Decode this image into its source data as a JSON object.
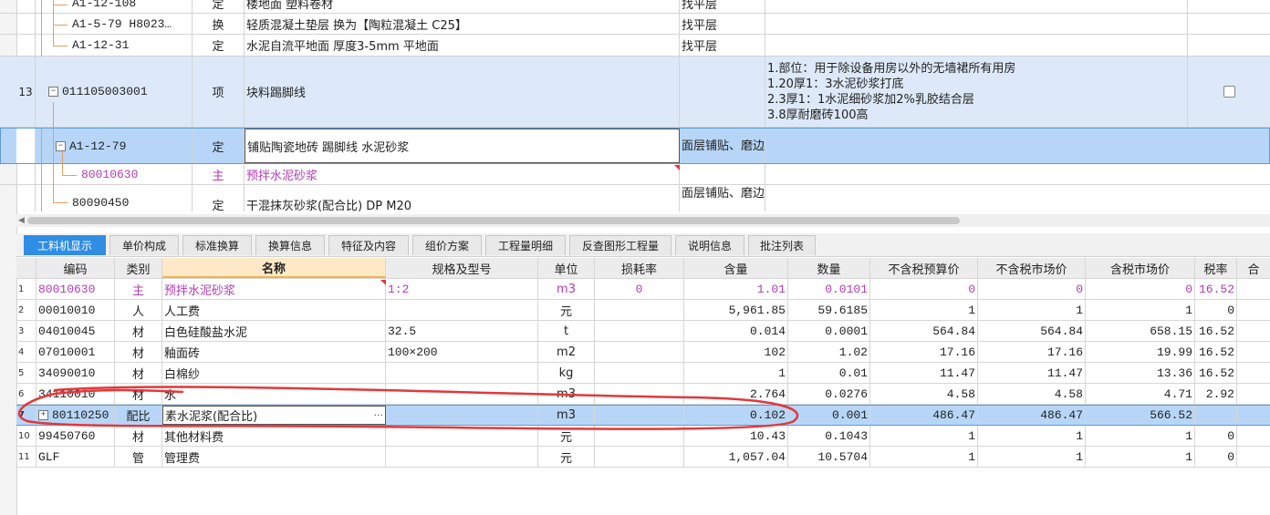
{
  "upper_rows": [
    {
      "num": "",
      "code": "A1-12-108",
      "type": "定",
      "name": "楼地面 塑料卷材",
      "part": "找平层",
      "desc": []
    },
    {
      "num": "",
      "code": "A1-5-79 H8023…",
      "type": "换",
      "name": "轻质混凝土垫层  换为【陶粒混凝土 C25】",
      "part": "找平层",
      "desc": []
    },
    {
      "num": "",
      "code": "A1-12-31",
      "type": "定",
      "name": "水泥自流平地面 厚度3-5mm 平地面",
      "part": "找平层",
      "desc": []
    },
    {
      "num": "13",
      "code": "011105003001",
      "type": "项",
      "name": "块料踢脚线",
      "part": "",
      "desc": [
        "1.部位：用于除设备用房以外的无墙裙所有用房",
        "1.20厚1：3水泥砂浆打底",
        "2.3厚1：1水泥细砂浆加2%乳胶结合层",
        "3.8厚耐磨砖100高"
      ]
    },
    {
      "num": "",
      "code": "A1-12-79",
      "type": "定",
      "name": "铺贴陶瓷地砖 踢脚线 水泥砂浆",
      "part": "面层铺贴、磨边",
      "desc": []
    },
    {
      "num": "",
      "code": "80010630",
      "type": "主",
      "name": "预拌水泥砂浆",
      "part": "",
      "desc": []
    },
    {
      "num": "",
      "code": "80090450",
      "type": "定",
      "name": "干混抹灰砂浆(配合比) DP M20",
      "part": "面层铺贴、磨边",
      "desc": []
    }
  ],
  "tabs": [
    "工料机显示",
    "单价构成",
    "标准换算",
    "换算信息",
    "特征及内容",
    "组价方案",
    "工程量明细",
    "反查图形工程量",
    "说明信息",
    "批注列表"
  ],
  "columns": [
    "编码",
    "类别",
    "名称",
    "规格及型号",
    "单位",
    "损耗率",
    "含量",
    "数量",
    "不含税预算价",
    "不含税市场价",
    "含税市场价",
    "税率",
    "合"
  ],
  "rows": [
    {
      "rn": "1",
      "code": "80010630",
      "type": "主",
      "name": "预拌水泥砂浆",
      "spec": "1:2",
      "unit": "m3",
      "loss": "0",
      "content": "1.01",
      "qty": "0.0101",
      "budget": "0",
      "market": "0",
      "taxmarket": "0",
      "tax": "16.52"
    },
    {
      "rn": "2",
      "code": "00010010",
      "type": "人",
      "name": "人工费",
      "spec": "",
      "unit": "元",
      "loss": "",
      "content": "5,961.85",
      "qty": "59.6185",
      "budget": "1",
      "market": "1",
      "taxmarket": "1",
      "tax": "0"
    },
    {
      "rn": "3",
      "code": "04010045",
      "type": "材",
      "name": "白色硅酸盐水泥",
      "spec": "32.5",
      "unit": "t",
      "loss": "",
      "content": "0.014",
      "qty": "0.0001",
      "budget": "564.84",
      "market": "564.84",
      "taxmarket": "658.15",
      "tax": "16.52"
    },
    {
      "rn": "4",
      "code": "07010001",
      "type": "材",
      "name": "釉面砖",
      "spec": "100×200",
      "unit": "m2",
      "loss": "",
      "content": "102",
      "qty": "1.02",
      "budget": "17.16",
      "market": "17.16",
      "taxmarket": "19.99",
      "tax": "16.52"
    },
    {
      "rn": "5",
      "code": "34090010",
      "type": "材",
      "name": "白棉纱",
      "spec": "",
      "unit": "kg",
      "loss": "",
      "content": "1",
      "qty": "0.01",
      "budget": "11.47",
      "market": "11.47",
      "taxmarket": "13.36",
      "tax": "16.52"
    },
    {
      "rn": "6",
      "code": "34110010",
      "type": "材",
      "name": "水",
      "spec": "",
      "unit": "m3",
      "loss": "",
      "content": "2.764",
      "qty": "0.0276",
      "budget": "4.58",
      "market": "4.58",
      "taxmarket": "4.71",
      "tax": "2.92"
    },
    {
      "rn": "7",
      "code": "80110250",
      "type": "配比",
      "name": "素水泥浆(配合比)",
      "spec": "",
      "unit": "m3",
      "loss": "",
      "content": "0.102",
      "qty": "0.001",
      "budget": "486.47",
      "market": "486.47",
      "taxmarket": "566.52",
      "tax": ""
    },
    {
      "rn": "10",
      "code": "99450760",
      "type": "材",
      "name": "其他材料费",
      "spec": "",
      "unit": "元",
      "loss": "",
      "content": "10.43",
      "qty": "0.1043",
      "budget": "1",
      "market": "1",
      "taxmarket": "1",
      "tax": "0"
    },
    {
      "rn": "11",
      "code": "GLF",
      "type": "管",
      "name": "管理费",
      "spec": "",
      "unit": "元",
      "loss": "",
      "content": "1,057.04",
      "qty": "10.5704",
      "budget": "1",
      "market": "1",
      "taxmarket": "1",
      "tax": "0"
    }
  ],
  "ellipsis_label": "···",
  "colors": {
    "accent": "#2f8de4",
    "selected": "#b7d6f7",
    "item_row": "#dde9f8",
    "purple": "#b23ab5",
    "annotation": "#e2383b"
  }
}
